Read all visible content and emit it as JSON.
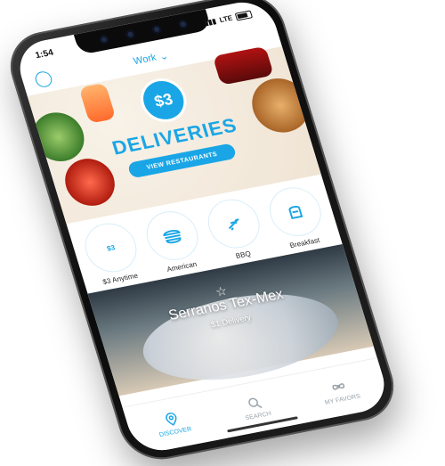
{
  "status": {
    "time": "1:54",
    "network": "LTE"
  },
  "header": {
    "location": "Work",
    "chevron": "chevron-down-icon"
  },
  "hero": {
    "price": "$3",
    "title": "DELIVERIES",
    "cta": "VIEW RESTAURANTS"
  },
  "categories": [
    {
      "label": "$3 Anytime",
      "icon": "dollar-badge"
    },
    {
      "label": "American",
      "icon": "burger-icon"
    },
    {
      "label": "BBQ",
      "icon": "bbq-icon"
    },
    {
      "label": "Breakfast",
      "icon": "breakfast-icon"
    }
  ],
  "featured": {
    "name": "Serranos Tex-Mex",
    "subtitle": "$1 Delivery"
  },
  "bottomnav": {
    "discover": "DISCOVER",
    "search": "SEARCH",
    "favorites": "MY FAVORS"
  },
  "colors": {
    "brand": "#1aa6e6",
    "text": "#2a2a2a"
  }
}
